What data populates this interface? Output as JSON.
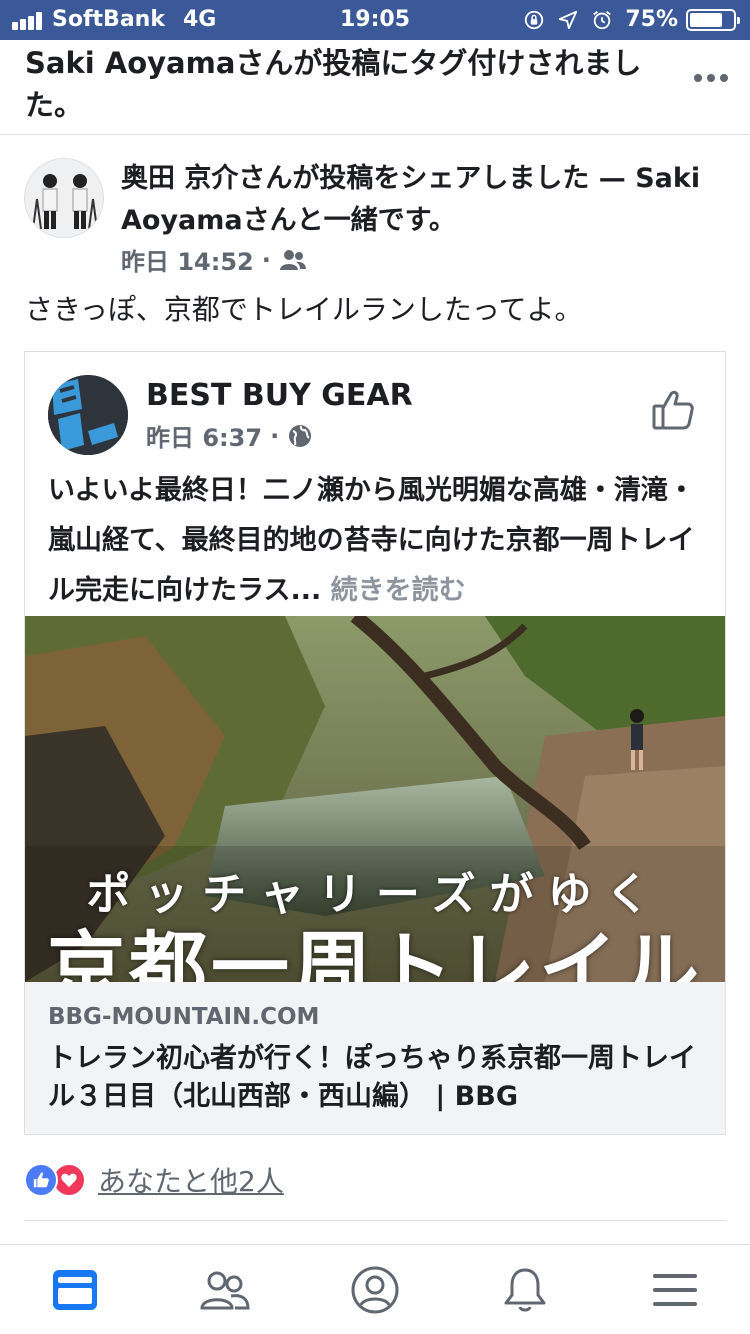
{
  "status_bar": {
    "carrier": "SoftBank",
    "network": "4G",
    "time": "19:05",
    "battery_percent": "75%",
    "battery_level": 0.75,
    "icons": [
      "signal-icon",
      "orientation-lock-icon",
      "location-icon",
      "alarm-icon",
      "battery-icon"
    ]
  },
  "notification": {
    "text": "Saki Aoyamaさんが投稿にタグ付けされました。",
    "menu_icon": "more-icon"
  },
  "post": {
    "header_text": "奥田 京介さんが投稿をシェアしました — Saki Aoyamaさんと一緒です。",
    "time": "昨日 14:52",
    "separator": "·",
    "audience_icon": "friends-icon",
    "body": "さきっぽ、京都でトレイルランしたってよ。"
  },
  "shared": {
    "page_name": "BEST BUY GEAR",
    "time": "昨日 6:37",
    "separator": "·",
    "audience_icon": "globe-icon",
    "like_icon": "thumbs-up-icon",
    "text": "いよいよ最終日！二ノ瀬から風光明媚な高雄・清滝・嵐山経て、最終目的地の苔寺に向けた京都一周トレイル完走に向けたラス...",
    "see_more": "続きを読む",
    "image_caption_small": "ポッチャリーズがゆく",
    "image_caption_large": "京都一周トレイル",
    "link_domain": "BBG-MOUNTAIN.COM",
    "link_title": "トレラン初心者が行く！ぽっちゃり系京都一周トレイル３日目（北山西部・西山編） | BBG"
  },
  "reactions": {
    "icons": [
      "like-reaction-icon",
      "love-reaction-icon"
    ],
    "summary": "あなたと他2人",
    "colors": {
      "like": "#4b7bf5",
      "love": "#f0395a"
    }
  },
  "tab_bar": {
    "tabs": [
      {
        "name": "news-feed",
        "icon": "news-feed-icon",
        "active": true
      },
      {
        "name": "friends",
        "icon": "friends-tab-icon",
        "active": false
      },
      {
        "name": "profile",
        "icon": "profile-icon",
        "active": false
      },
      {
        "name": "notifications",
        "icon": "bell-icon",
        "active": false
      },
      {
        "name": "menu",
        "icon": "hamburger-menu-icon",
        "active": false
      }
    ]
  },
  "colors": {
    "brand": "#3b5998",
    "active_tab": "#1877f2",
    "inactive_icon": "#606770",
    "link_box_bg": "#f2f3f5"
  }
}
